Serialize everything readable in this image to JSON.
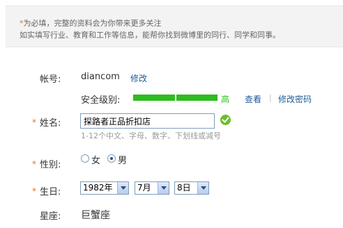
{
  "notice": {
    "required_mark": "*",
    "line1": "为必填，完整的资料会为你带来更多关注",
    "line2": "如实填写行业、教育和工作等信息，能帮你找到微博里的同行、同学和同事。"
  },
  "account": {
    "label": "帐号:",
    "value": "diancom",
    "edit_link": "修改"
  },
  "security": {
    "label": "安全级别:",
    "level_fraction": 1.0,
    "level_text": "高",
    "view_link": "查看",
    "separator": "|",
    "change_password_link": "修改密码"
  },
  "name": {
    "required_mark": "*",
    "label": "姓名:",
    "value": "探路者正品折扣店",
    "hint": "1-12个中文、字母、数字、下划线或减号"
  },
  "gender": {
    "required_mark": "*",
    "label": "性别:",
    "options": [
      "女",
      "男"
    ],
    "selected": "男"
  },
  "birthday": {
    "required_mark": "*",
    "label": "生日:",
    "year": "1982年",
    "month": "7月",
    "day": "8日"
  },
  "zodiac": {
    "label": "星座:",
    "value": "巨蟹座"
  },
  "colors": {
    "required": "#e4741f",
    "link": "#1f5b9a",
    "security_bar": "#2dbc20",
    "ok_icon": "#6cbf2c"
  }
}
